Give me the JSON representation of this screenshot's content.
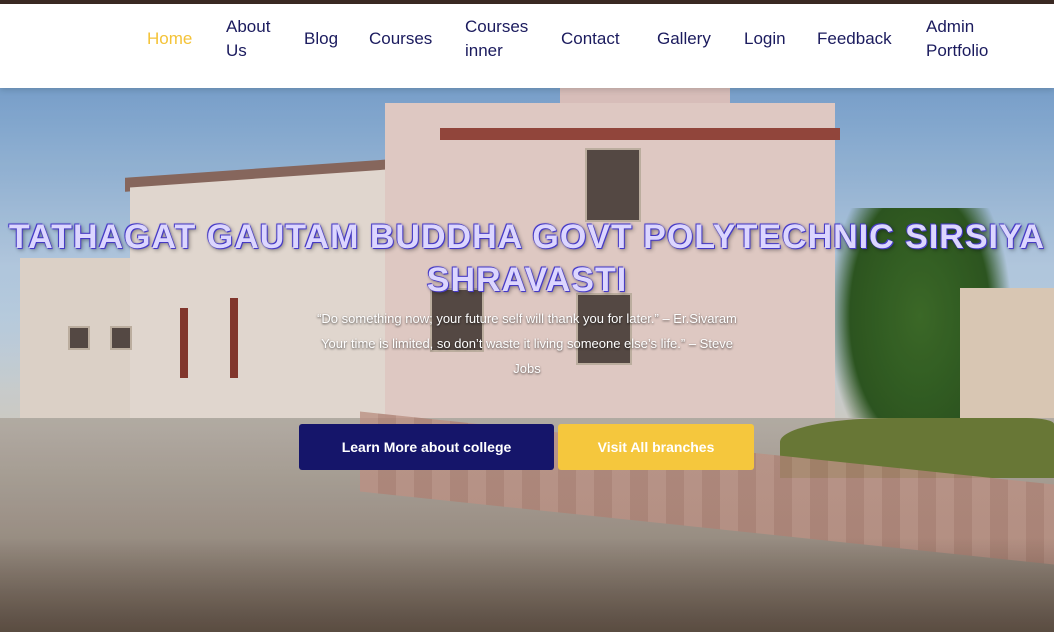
{
  "nav": {
    "home": "Home",
    "about_line1": "About",
    "about_line2": "Us",
    "blog": "Blog",
    "courses": "Courses",
    "courses_inner_line1": "Courses",
    "courses_inner_line2": "inner",
    "contact": "Contact",
    "gallery": "Gallery",
    "login": "Login",
    "feedback": "Feedback",
    "admin_line1": "Admin",
    "admin_line2": "Portfolio"
  },
  "hero": {
    "title_line1": "TATHAGAT GAUTAM BUDDHA GOVT POLYTECHNIC SIRSIYA",
    "title_line2": "SHRAVASTI",
    "quote_line1": "“Do something now; your future self will thank you for later.” – Er.Sivaram",
    "quote_line2": "Your time is limited, so don’t waste it living someone else’s life.” – Steve",
    "quote_line3": "Jobs",
    "primary_button": "Learn More about college",
    "secondary_button": "Visit All branches"
  },
  "colors": {
    "nav_text": "#1b1b5e",
    "nav_active": "#f4c338",
    "primary_button": "#15156a",
    "secondary_button": "#f5c73d",
    "title_text": "#dcd6ff"
  }
}
